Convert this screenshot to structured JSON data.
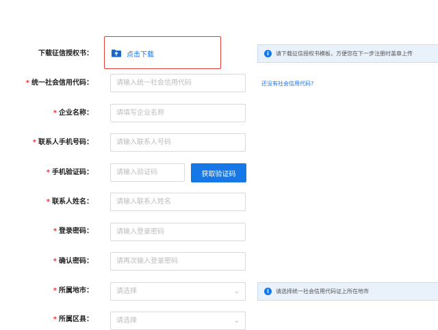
{
  "download": {
    "label": "下载征信授权书：",
    "link_text": "点击下载",
    "notice": "请下载征信授权书模板，方便您在下一步注册时盖章上传"
  },
  "form": {
    "required_mark": "*",
    "credit_code": {
      "label": "统一社会信用代码：",
      "placeholder": "请输入统一社会信用代码",
      "help_link": "还没有社会信用代码?"
    },
    "company_name": {
      "label": "企业名称：",
      "placeholder": "请填写企业名称"
    },
    "contact_phone": {
      "label": "联系人手机号码：",
      "placeholder": "请输入联系人号码"
    },
    "sms_code": {
      "label": "手机验证码：",
      "placeholder": "请输入验证码",
      "button": "获取验证码"
    },
    "contact_name": {
      "label": "联系人姓名：",
      "placeholder": "请输入联系人姓名"
    },
    "password": {
      "label": "登录密码：",
      "placeholder": "请输入登录密码"
    },
    "confirm_password": {
      "label": "确认密码：",
      "placeholder": "请再次输入登录密码"
    },
    "region": {
      "label": "所属地市：",
      "selected": "请选择",
      "notice": "请选择统一社会信用代码证上所在地市"
    },
    "district": {
      "label": "所属区县：",
      "selected": "请选择"
    }
  },
  "colors": {
    "primary": "#1677e6",
    "required": "#e4393c",
    "highlight_border": "#e23b34",
    "notice_bg": "#e9f1fb"
  },
  "icons": {
    "download": "folder-upload-icon",
    "info": "info-circle-icon",
    "select": "chevron-down-icon"
  }
}
